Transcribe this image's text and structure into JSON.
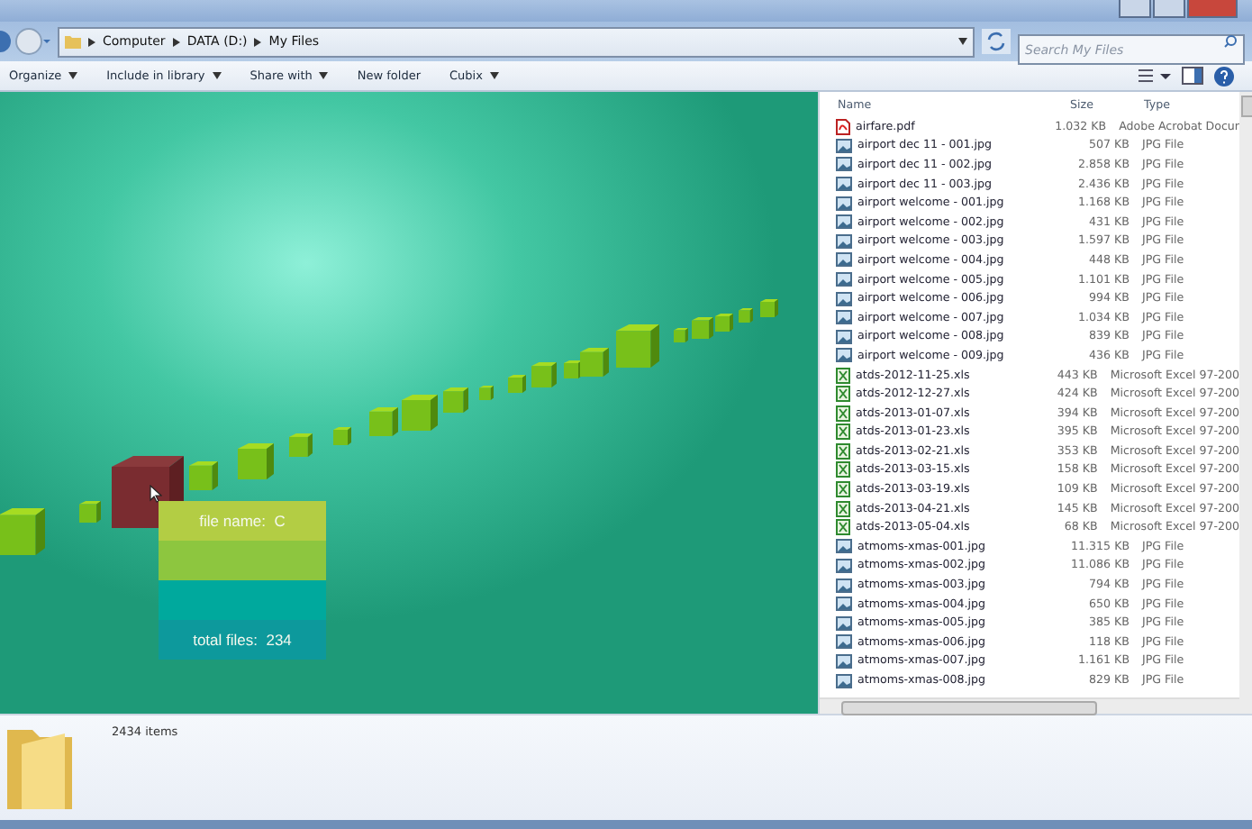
{
  "breadcrumb": [
    "Computer",
    "DATA (D:)",
    "My Files"
  ],
  "search": {
    "placeholder": "Search My Files"
  },
  "toolbar": [
    "Organize",
    "Include in library",
    "Share with",
    "New folder",
    "Cubix"
  ],
  "toolbar_dropdown": [
    true,
    true,
    true,
    false,
    true
  ],
  "visualization": {
    "tooltip": {
      "file_name_label": "file name:",
      "file_name": "C",
      "total_files_label": "total files:",
      "total_files": "234"
    }
  },
  "file_list": {
    "columns": [
      "Name",
      "Size",
      "Type"
    ],
    "rows": [
      {
        "kind": "pdf",
        "name": "airfare.pdf",
        "size": "1.032 KB",
        "type": "Adobe Acrobat Docur"
      },
      {
        "kind": "jpg",
        "name": "airport dec 11 - 001.jpg",
        "size": "507 KB",
        "type": "JPG File"
      },
      {
        "kind": "jpg",
        "name": "airport dec 11 - 002.jpg",
        "size": "2.858 KB",
        "type": "JPG File"
      },
      {
        "kind": "jpg",
        "name": "airport dec 11 - 003.jpg",
        "size": "2.436 KB",
        "type": "JPG File"
      },
      {
        "kind": "jpg",
        "name": "airport welcome - 001.jpg",
        "size": "1.168 KB",
        "type": "JPG File"
      },
      {
        "kind": "jpg",
        "name": "airport welcome - 002.jpg",
        "size": "431 KB",
        "type": "JPG File"
      },
      {
        "kind": "jpg",
        "name": "airport welcome - 003.jpg",
        "size": "1.597 KB",
        "type": "JPG File"
      },
      {
        "kind": "jpg",
        "name": "airport welcome - 004.jpg",
        "size": "448 KB",
        "type": "JPG File"
      },
      {
        "kind": "jpg",
        "name": "airport welcome - 005.jpg",
        "size": "1.101 KB",
        "type": "JPG File"
      },
      {
        "kind": "jpg",
        "name": "airport welcome - 006.jpg",
        "size": "994 KB",
        "type": "JPG File"
      },
      {
        "kind": "jpg",
        "name": "airport welcome - 007.jpg",
        "size": "1.034 KB",
        "type": "JPG File"
      },
      {
        "kind": "jpg",
        "name": "airport welcome - 008.jpg",
        "size": "839 KB",
        "type": "JPG File"
      },
      {
        "kind": "jpg",
        "name": "airport welcome - 009.jpg",
        "size": "436 KB",
        "type": "JPG File"
      },
      {
        "kind": "xls",
        "name": "atds-2012-11-25.xls",
        "size": "443 KB",
        "type": "Microsoft Excel 97-200"
      },
      {
        "kind": "xls",
        "name": "atds-2012-12-27.xls",
        "size": "424 KB",
        "type": "Microsoft Excel 97-200"
      },
      {
        "kind": "xls",
        "name": "atds-2013-01-07.xls",
        "size": "394 KB",
        "type": "Microsoft Excel 97-200"
      },
      {
        "kind": "xls",
        "name": "atds-2013-01-23.xls",
        "size": "395 KB",
        "type": "Microsoft Excel 97-200"
      },
      {
        "kind": "xls",
        "name": "atds-2013-02-21.xls",
        "size": "353 KB",
        "type": "Microsoft Excel 97-200"
      },
      {
        "kind": "xls",
        "name": "atds-2013-03-15.xls",
        "size": "158 KB",
        "type": "Microsoft Excel 97-200"
      },
      {
        "kind": "xls",
        "name": "atds-2013-03-19.xls",
        "size": "109 KB",
        "type": "Microsoft Excel 97-200"
      },
      {
        "kind": "xls",
        "name": "atds-2013-04-21.xls",
        "size": "145 KB",
        "type": "Microsoft Excel 97-200"
      },
      {
        "kind": "xls",
        "name": "atds-2013-05-04.xls",
        "size": "68 KB",
        "type": "Microsoft Excel 97-200"
      },
      {
        "kind": "jpg",
        "name": "atmoms-xmas-001.jpg",
        "size": "11.315 KB",
        "type": "JPG File"
      },
      {
        "kind": "jpg",
        "name": "atmoms-xmas-002.jpg",
        "size": "11.086 KB",
        "type": "JPG File"
      },
      {
        "kind": "jpg",
        "name": "atmoms-xmas-003.jpg",
        "size": "794 KB",
        "type": "JPG File"
      },
      {
        "kind": "jpg",
        "name": "atmoms-xmas-004.jpg",
        "size": "650 KB",
        "type": "JPG File"
      },
      {
        "kind": "jpg",
        "name": "atmoms-xmas-005.jpg",
        "size": "385 KB",
        "type": "JPG File"
      },
      {
        "kind": "jpg",
        "name": "atmoms-xmas-006.jpg",
        "size": "118 KB",
        "type": "JPG File"
      },
      {
        "kind": "jpg",
        "name": "atmoms-xmas-007.jpg",
        "size": "1.161 KB",
        "type": "JPG File"
      },
      {
        "kind": "jpg",
        "name": "atmoms-xmas-008.jpg",
        "size": "829 KB",
        "type": "JPG File"
      }
    ]
  },
  "status_bar": {
    "item_count": "2434 items"
  }
}
